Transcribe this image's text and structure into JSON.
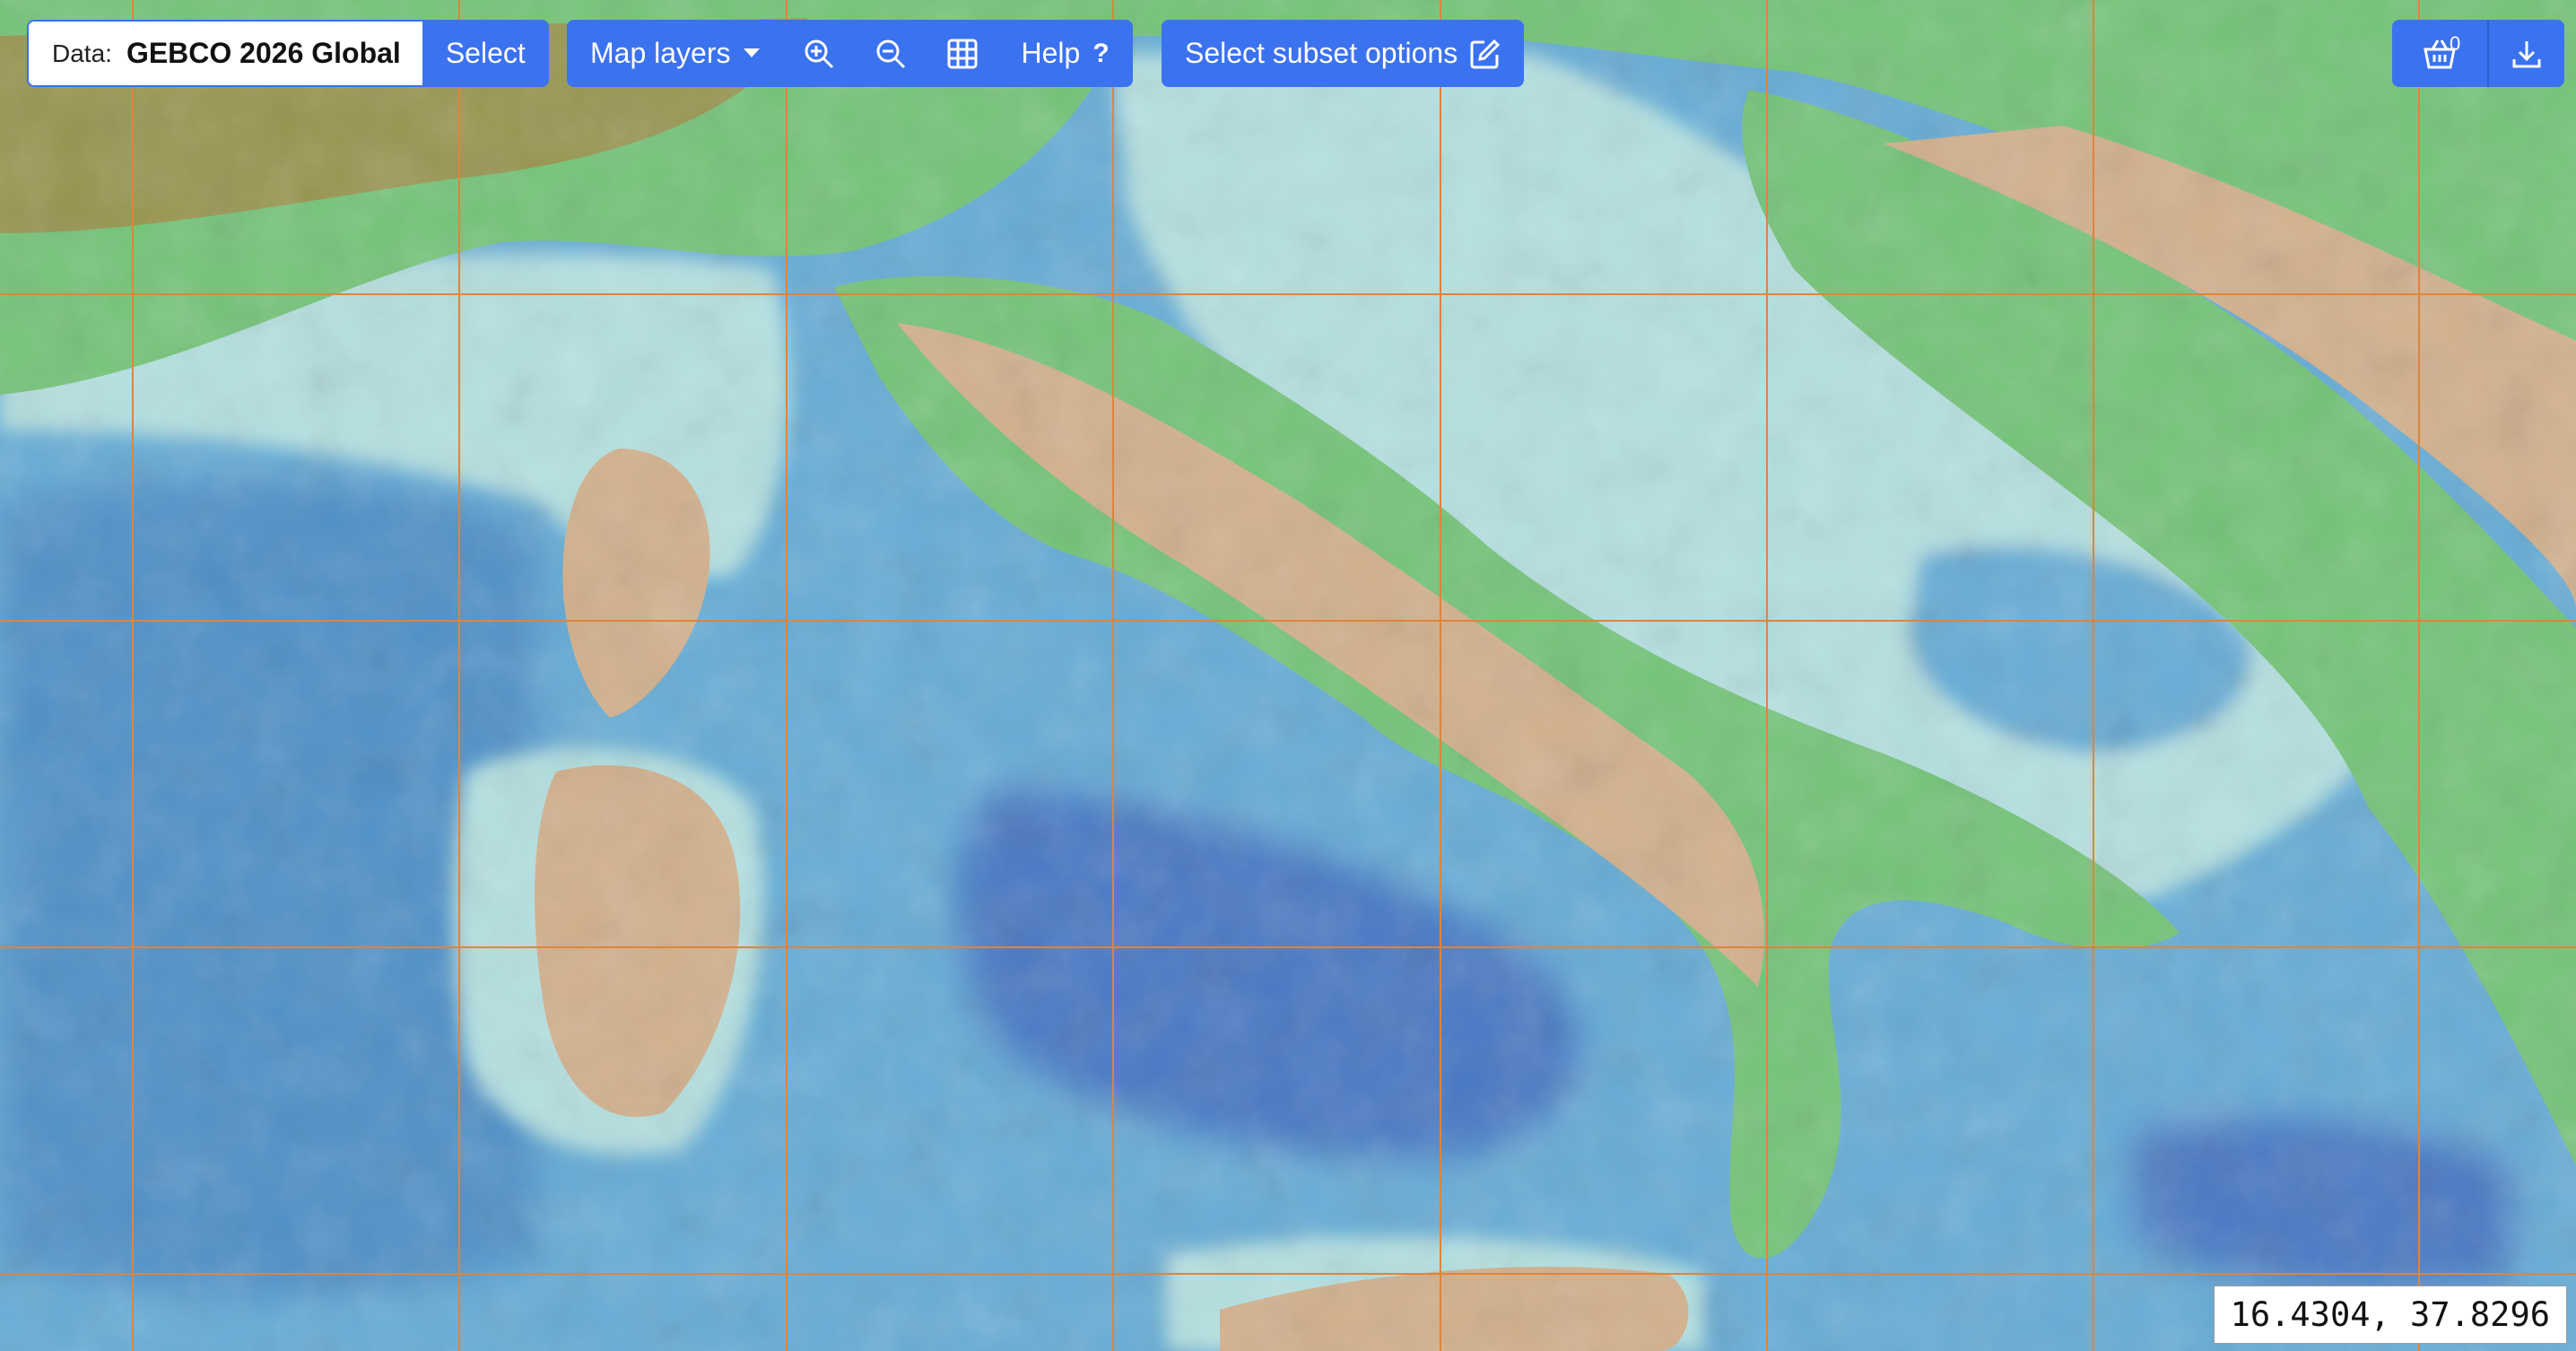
{
  "data_selector": {
    "label": "Data:",
    "value": "GEBCO 2026 Global",
    "select_label": "Select"
  },
  "toolbar": {
    "map_layers_label": "Map layers",
    "help_label": "Help",
    "subset_label": "Select subset options",
    "basket_count": "0"
  },
  "coordinates": {
    "text": "16.4304, 37.8296"
  },
  "map": {
    "grid_color": "#e0843a",
    "deep_sea_color": "#4a78c4",
    "sea_color": "#66acd6",
    "shallow_color": "#b4e0e0",
    "lowland_color": "#74c478",
    "upland_color": "#d2b08c",
    "mountain_color": "#a8823f"
  }
}
